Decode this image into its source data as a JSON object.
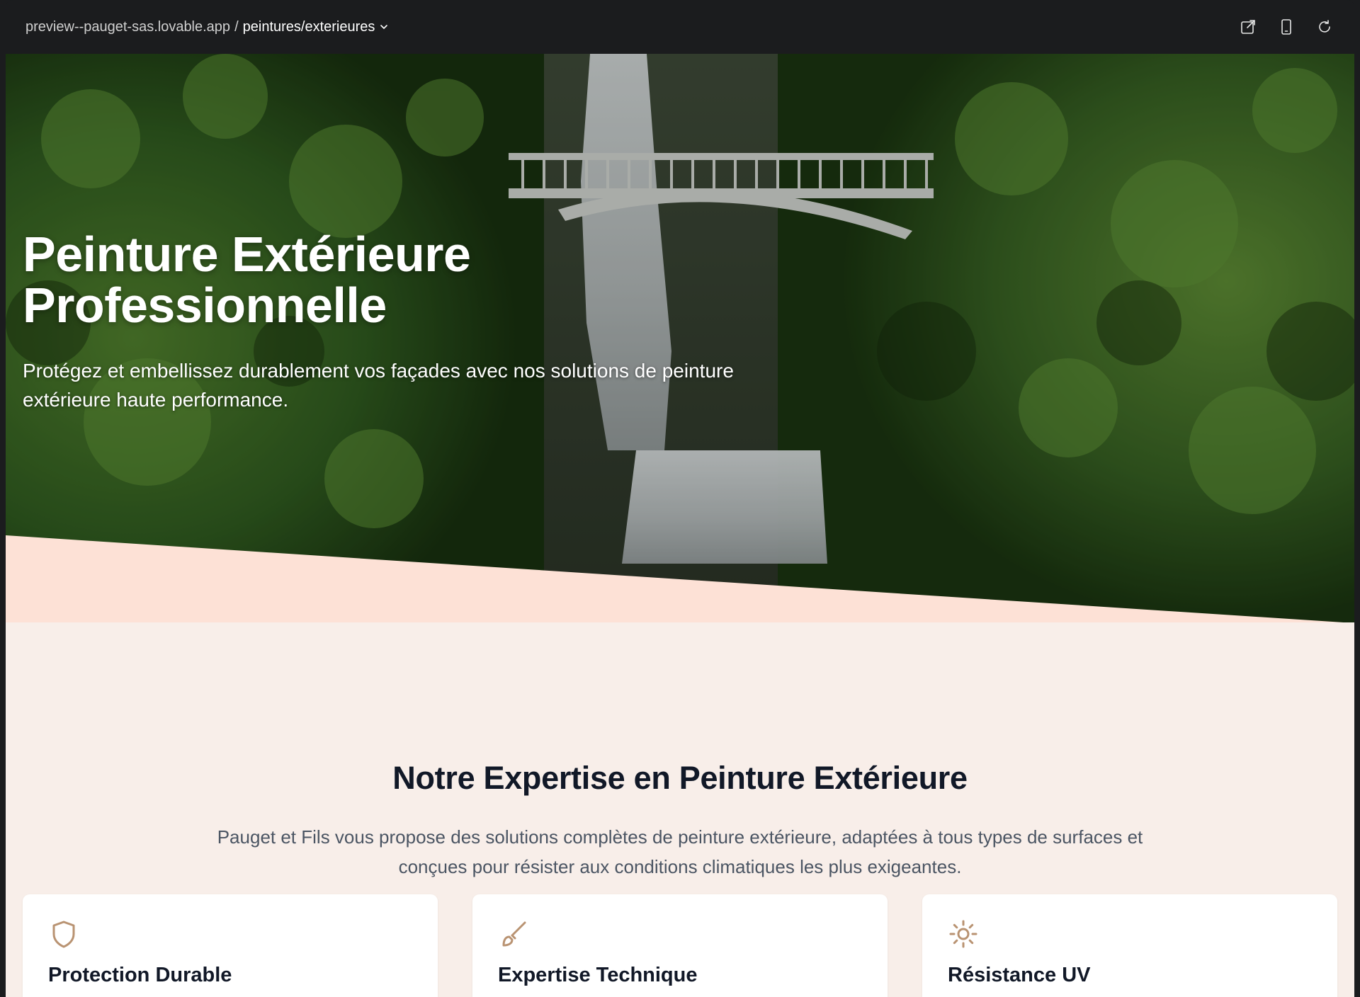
{
  "address_bar": {
    "host": "preview--pauget-sas.lovable.app",
    "separator": "/",
    "path": "peintures/exterieures",
    "actions": [
      "open-external-icon",
      "mobile-preview-icon",
      "refresh-icon"
    ]
  },
  "hero": {
    "title_line1": "Peinture Extérieure",
    "title_line2": "Professionnelle",
    "subtitle": "Protégez et embellissez durablement vos façades avec nos solutions de peinture extérieure haute performance."
  },
  "expertise": {
    "title": "Notre Expertise en Peinture Extérieure",
    "description": "Pauget et Fils vous propose des solutions complètes de peinture extérieure, adaptées à tous types de surfaces et conçues pour résister aux conditions climatiques les plus exigeantes.",
    "cards": [
      {
        "icon": "shield-icon",
        "title": "Protection Durable"
      },
      {
        "icon": "paintbrush-icon",
        "title": "Expertise Technique"
      },
      {
        "icon": "sun-icon",
        "title": "Résistance UV"
      }
    ]
  },
  "colors": {
    "accent_icon": "#b99372",
    "page_bg": "#f8eee9",
    "hero_cut": "#fde1d6",
    "title_dark": "#111827",
    "text_gray": "#4b5563"
  }
}
